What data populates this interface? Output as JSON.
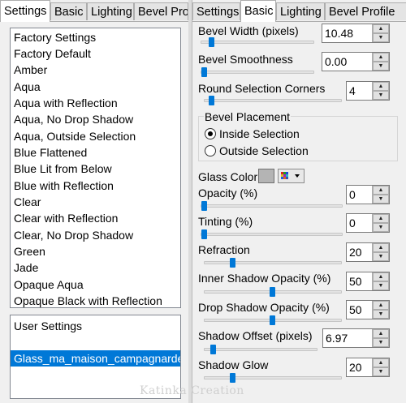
{
  "left": {
    "tabs": [
      "Settings",
      "Basic",
      "Lighting",
      "Bevel Profile"
    ],
    "presets": [
      "Factory Settings",
      "Factory Default",
      "Amber",
      "Aqua",
      "Aqua with Reflection",
      "Aqua, No Drop Shadow",
      "Aqua, Outside Selection",
      "Blue Flattened",
      "Blue Lit from Below",
      "Blue with Reflection",
      "Clear",
      "Clear with Reflection",
      "Clear, No Drop Shadow",
      "Green",
      "Jade",
      "Opaque Aqua",
      "Opaque Black with Reflection"
    ],
    "user_header": "User Settings",
    "user_presets": [
      "Glass_ma_maison_campagnarde"
    ]
  },
  "right": {
    "tabs": [
      "Settings",
      "Basic",
      "Lighting",
      "Bevel Profile"
    ],
    "bevel_width": {
      "label": "Bevel Width (pixels)",
      "value": "10.48"
    },
    "bevel_smoothness": {
      "label": "Bevel Smoothness",
      "value": "0.00"
    },
    "round_corners": {
      "label": "Round Selection Corners",
      "value": "4"
    },
    "bevel_placement": {
      "label": "Bevel Placement",
      "inside": "Inside Selection",
      "outside": "Outside Selection"
    },
    "glass_color": {
      "label": "Glass Color",
      "swatch": "#b4b4b4"
    },
    "opacity": {
      "label": "Opacity (%)",
      "value": "0"
    },
    "tinting": {
      "label": "Tinting (%)",
      "value": "0"
    },
    "refraction": {
      "label": "Refraction",
      "value": "20"
    },
    "inner_shadow": {
      "label": "Inner Shadow Opacity (%)",
      "value": "50"
    },
    "drop_shadow": {
      "label": "Drop Shadow Opacity (%)",
      "value": "50"
    },
    "shadow_offset": {
      "label": "Shadow Offset (pixels)",
      "value": "6.97"
    },
    "shadow_glow": {
      "label": "Shadow Glow",
      "value": "20"
    }
  },
  "watermark": "Katinka Creation",
  "colors": {
    "accent": "#0078d7",
    "panel": "#f0f0f0"
  },
  "icons": [
    "spin-up-icon",
    "spin-down-icon",
    "color-palette-icon",
    "dropdown-arrow-icon"
  ]
}
